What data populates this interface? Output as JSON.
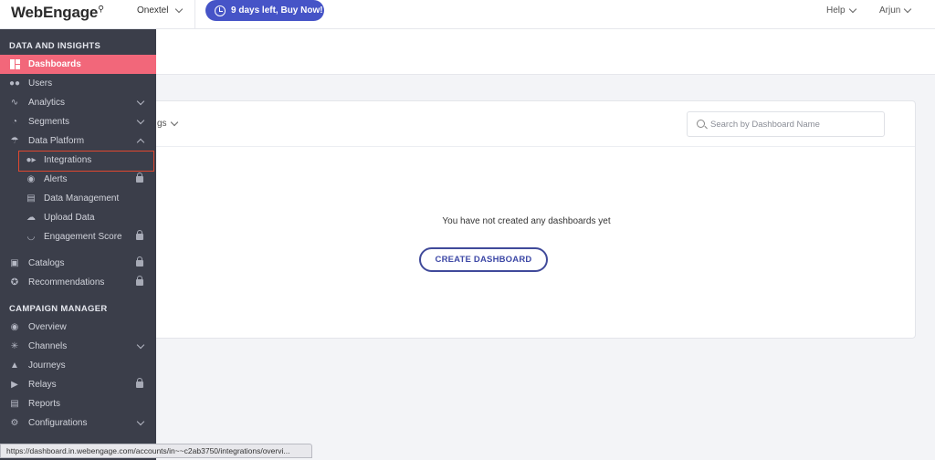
{
  "topbar": {
    "logo_text": "WebEngage",
    "account_name": "Onextel",
    "trial_text": "9 days left, Buy Now!",
    "help_label": "Help",
    "user_name": "Arjun"
  },
  "sidebar": {
    "section_data": "DATA AND INSIGHTS",
    "section_campaign": "CAMPAIGN MANAGER",
    "items": {
      "dashboards": "Dashboards",
      "users": "Users",
      "analytics": "Analytics",
      "segments": "Segments",
      "data_platform": "Data Platform",
      "integrations": "Integrations",
      "alerts": "Alerts",
      "data_management": "Data Management",
      "upload_data": "Upload Data",
      "engagement_score": "Engagement Score",
      "catalogs": "Catalogs",
      "recommendations": "Recommendations",
      "overview": "Overview",
      "channels": "Channels",
      "journeys": "Journeys",
      "relays": "Relays",
      "reports": "Reports",
      "configurations": "Configurations"
    }
  },
  "main": {
    "tags_label": "gs",
    "search_placeholder": "Search by Dashboard Name",
    "empty_message": "You have not created any dashboards yet",
    "create_button": "CREATE DASHBOARD"
  },
  "statusbar": {
    "url": "https://dashboard.in.webengage.com/accounts/in~~c2ab3750/integrations/overvi..."
  },
  "colors": {
    "sidebar_bg": "#3b3e4a",
    "active_item": "#f2677a",
    "primary": "#4654c7",
    "highlight_border": "#e0472f"
  }
}
